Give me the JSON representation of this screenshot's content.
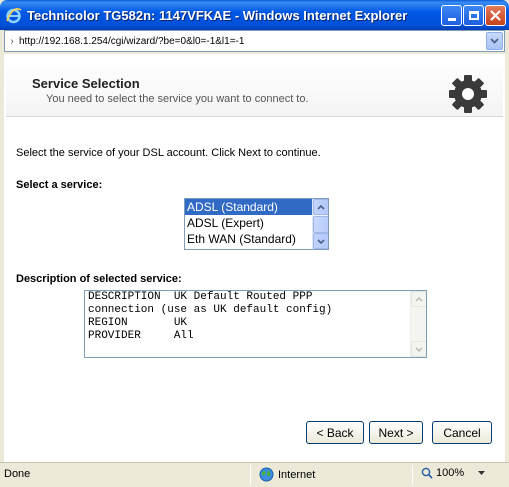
{
  "window": {
    "title": "Technicolor TG582n:  1147VFKAE - Windows Internet Explorer",
    "address": "http://192.168.1.254/cgi/wizard/?be=0&l0=-1&l1=-1"
  },
  "header": {
    "title": "Service Selection",
    "subtitle": "You need to select the service you want to connect to."
  },
  "main": {
    "intro": "Select the service of your DSL account. Click Next to continue.",
    "select_label": "Select a service:",
    "services": [
      {
        "label": "ADSL (Standard)",
        "selected": true
      },
      {
        "label": "ADSL (Expert)",
        "selected": false
      },
      {
        "label": "Eth WAN (Standard)",
        "selected": false
      }
    ],
    "description_label": "Description of selected service:",
    "description_lines": [
      "DESCRIPTION  UK Default Routed PPP",
      "connection (use as UK default config)",
      "REGION       UK",
      "PROVIDER     All"
    ]
  },
  "buttons": {
    "back": "< Back",
    "next": "Next >",
    "cancel": "Cancel"
  },
  "statusbar": {
    "status": "Done",
    "zone": "Internet",
    "zoom": "100%"
  },
  "colors": {
    "titlebar": "#0058e6",
    "selection": "#316ac5"
  }
}
